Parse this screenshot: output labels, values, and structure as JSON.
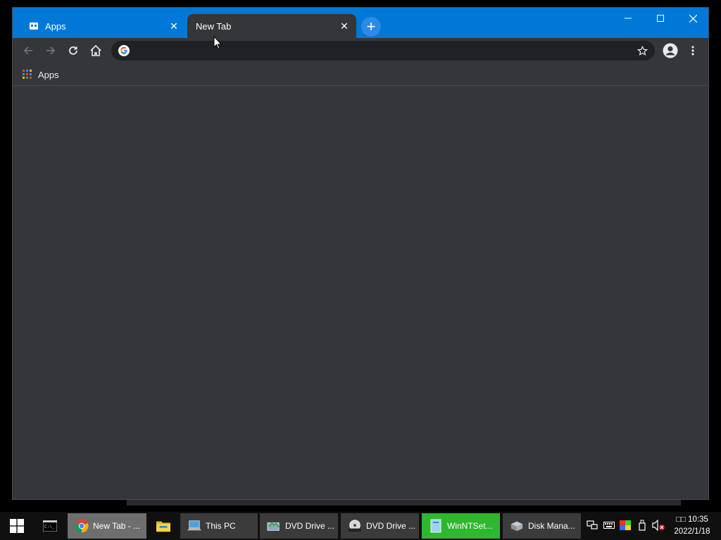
{
  "browser": {
    "tabs": [
      {
        "title": "Apps",
        "icon": "apps-page-icon",
        "active": false
      },
      {
        "title": "New Tab",
        "icon": "none",
        "active": true
      }
    ],
    "window_controls": {
      "minimize": "—",
      "maximize": "☐",
      "close": "✕"
    },
    "toolbar": {
      "back_icon": "arrow-left-icon",
      "forward_icon": "arrow-right-icon",
      "reload_icon": "reload-icon",
      "home_icon": "home-icon",
      "omnibox_value": "",
      "omnibox_icon": "google-icon",
      "bookmark_icon": "star-icon",
      "profile_icon": "account-icon",
      "menu_icon": "kebab-menu-icon"
    },
    "bookmarks_bar": {
      "items": [
        {
          "label": "Apps",
          "icon": "apps-grid-icon"
        }
      ]
    },
    "colors": {
      "titlebar": "#0078d7",
      "frame": "#35363a",
      "omnibox": "#202124"
    }
  },
  "taskbar": {
    "apps": [
      {
        "label": "",
        "icon": "cmd-icon"
      },
      {
        "label": "New Tab - ...",
        "icon": "chrome-icon"
      },
      {
        "label": "",
        "icon": "file-explorer-icon"
      },
      {
        "label": "This PC",
        "icon": "this-pc-icon"
      },
      {
        "label": "DVD Drive ...",
        "icon": "dvd-drive-icon"
      },
      {
        "label": "DVD Drive ...",
        "icon": "dvd-rom-icon"
      },
      {
        "label": "WinNTSet...",
        "icon": "winntsetup-icon"
      },
      {
        "label": "Disk Mana...",
        "icon": "disk-management-icon"
      }
    ],
    "clock": {
      "time": "□□ 10:35",
      "date": "2022/1/18"
    }
  }
}
